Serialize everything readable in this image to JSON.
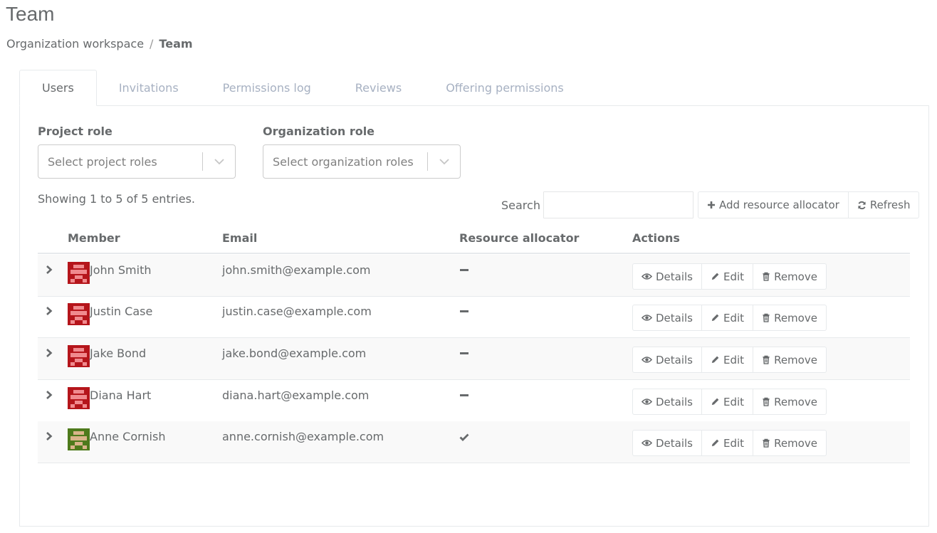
{
  "page": {
    "title": "Team",
    "breadcrumb": {
      "parent": "Organization workspace",
      "separator": "/",
      "current": "Team"
    }
  },
  "tabs": [
    {
      "label": "Users",
      "active": true
    },
    {
      "label": "Invitations",
      "active": false
    },
    {
      "label": "Permissions log",
      "active": false
    },
    {
      "label": "Reviews",
      "active": false
    },
    {
      "label": "Offering permissions",
      "active": false
    }
  ],
  "filters": {
    "project_role": {
      "label": "Project role",
      "placeholder": "Select project roles"
    },
    "organization_role": {
      "label": "Organization role",
      "placeholder": "Select organization roles"
    }
  },
  "table_toolbar": {
    "showing": "Showing 1 to 5 of 5 entries.",
    "search_label": "Search",
    "search_value": "",
    "add_button": "Add resource allocator",
    "refresh_button": "Refresh"
  },
  "table": {
    "columns": [
      "Member",
      "Email",
      "Resource allocator",
      "Actions"
    ],
    "rows": [
      {
        "name": "John Smith",
        "email": "john.smith@example.com",
        "resource_allocator": false,
        "avatar_color": "#b5151b"
      },
      {
        "name": "Justin Case",
        "email": "justin.case@example.com",
        "resource_allocator": false,
        "avatar_color": "#b5151b"
      },
      {
        "name": "Jake Bond",
        "email": "jake.bond@example.com",
        "resource_allocator": false,
        "avatar_color": "#b5151b"
      },
      {
        "name": "Diana Hart",
        "email": "diana.hart@example.com",
        "resource_allocator": false,
        "avatar_color": "#b5151b"
      },
      {
        "name": "Anne Cornish",
        "email": "anne.cornish@example.com",
        "resource_allocator": true,
        "avatar_color": "#4e7a1c"
      }
    ],
    "row_actions": {
      "details": "Details",
      "edit": "Edit",
      "remove": "Remove"
    }
  },
  "icons": {
    "add": "plus-icon",
    "refresh": "refresh-icon",
    "expand": "chevron-right-icon",
    "details": "eye-icon",
    "edit": "pencil-icon",
    "remove": "trash-icon",
    "allocator_yes": "check-icon",
    "allocator_no": "minus-icon",
    "select": "chevron-down-icon"
  }
}
